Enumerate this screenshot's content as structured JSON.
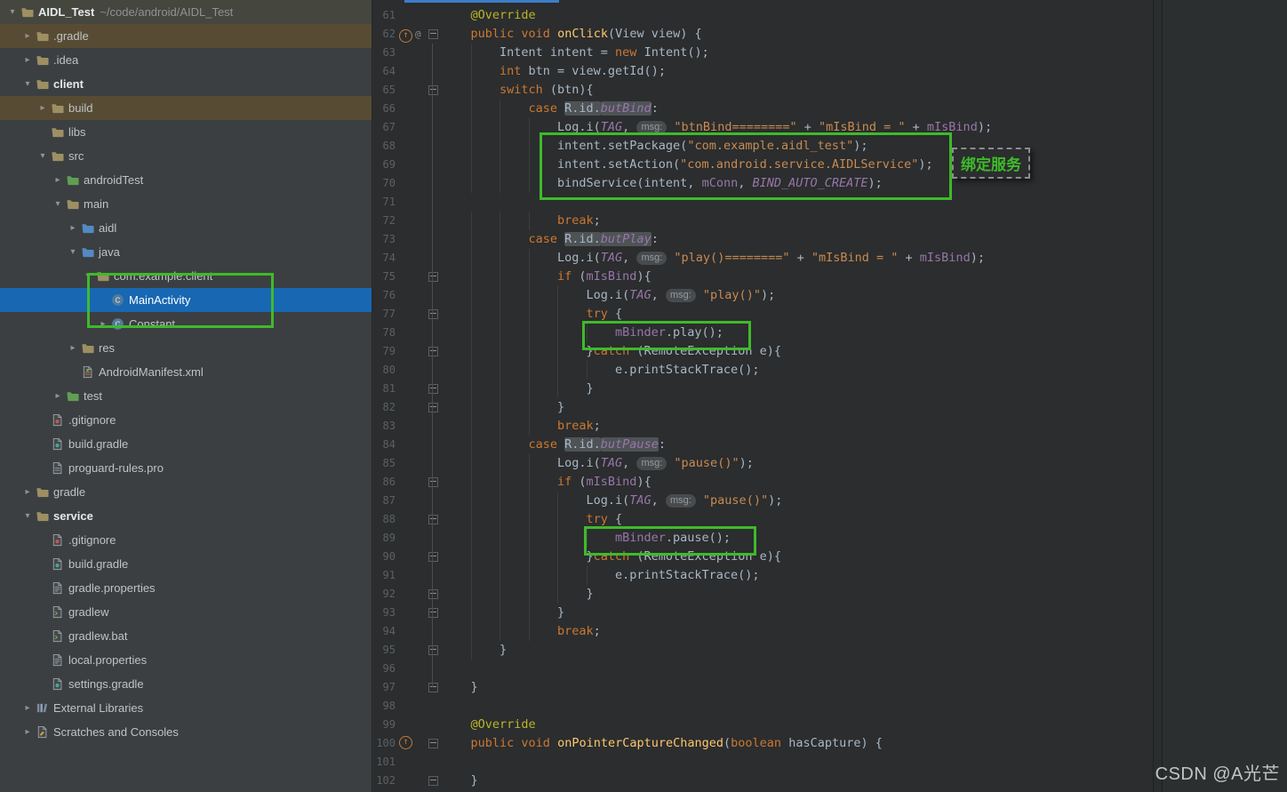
{
  "window": {
    "watermark": "CSDN @A光芒"
  },
  "annotations": {
    "bind_service_label": "绑定服务"
  },
  "sidebar": {
    "items": [
      {
        "label": "AIDL_Test",
        "path": " ~/code/android/AIDL_Test",
        "level": 0,
        "expanded": true,
        "icon": "folder",
        "bold": true,
        "row": "top"
      },
      {
        "label": ".gradle",
        "level": 1,
        "expanded": false,
        "icon": "folder",
        "row": "brown"
      },
      {
        "label": ".idea",
        "level": 1,
        "expanded": false,
        "icon": "folder"
      },
      {
        "label": "client",
        "level": 1,
        "expanded": true,
        "icon": "folder",
        "bold": true
      },
      {
        "label": "build",
        "level": 2,
        "expanded": false,
        "icon": "folder",
        "row": "brown"
      },
      {
        "label": "libs",
        "level": 2,
        "icon": "folder"
      },
      {
        "label": "src",
        "level": 2,
        "expanded": true,
        "icon": "folder"
      },
      {
        "label": "androidTest",
        "level": 3,
        "expanded": false,
        "icon": "folder-green"
      },
      {
        "label": "main",
        "level": 3,
        "expanded": true,
        "icon": "folder"
      },
      {
        "label": "aidl",
        "level": 4,
        "expanded": false,
        "icon": "folder-blue"
      },
      {
        "label": "java",
        "level": 4,
        "expanded": true,
        "icon": "folder-blue"
      },
      {
        "label": "com.example.client",
        "level": 5,
        "expanded": true,
        "icon": "package"
      },
      {
        "label": "MainActivity",
        "level": 6,
        "icon": "class",
        "row": "selected"
      },
      {
        "label": "Constant",
        "level": 6,
        "expanded": false,
        "icon": "class"
      },
      {
        "label": "res",
        "level": 4,
        "expanded": false,
        "icon": "folder"
      },
      {
        "label": "AndroidManifest.xml",
        "level": 4,
        "icon": "manifest"
      },
      {
        "label": "test",
        "level": 3,
        "expanded": false,
        "icon": "folder-green"
      },
      {
        "label": ".gitignore",
        "level": 2,
        "icon": "gitignore"
      },
      {
        "label": "build.gradle",
        "level": 2,
        "icon": "gradle"
      },
      {
        "label": "proguard-rules.pro",
        "level": 2,
        "icon": "file"
      },
      {
        "label": "gradle",
        "level": 1,
        "expanded": false,
        "icon": "folder"
      },
      {
        "label": "service",
        "level": 1,
        "expanded": true,
        "icon": "folder",
        "bold": true
      },
      {
        "label": ".gitignore",
        "level": 2,
        "icon": "gitignore"
      },
      {
        "label": "build.gradle",
        "level": 2,
        "icon": "gradle"
      },
      {
        "label": "gradle.properties",
        "level": 2,
        "icon": "properties"
      },
      {
        "label": "gradlew",
        "level": 2,
        "icon": "gradlew"
      },
      {
        "label": "gradlew.bat",
        "level": 2,
        "icon": "gradlew"
      },
      {
        "label": "local.properties",
        "level": 2,
        "icon": "properties"
      },
      {
        "label": "settings.gradle",
        "level": 2,
        "icon": "gradle"
      },
      {
        "label": "External Libraries",
        "level": 1,
        "expanded": false,
        "icon": "library"
      },
      {
        "label": "Scratches and Consoles",
        "level": 1,
        "expanded": false,
        "icon": "scratch"
      }
    ]
  },
  "editor": {
    "lines": [
      {
        "n": 61,
        "ind": 1,
        "tokens": [
          [
            "ann",
            "@Override"
          ]
        ]
      },
      {
        "n": 62,
        "ind": 1,
        "gutter": [
          "override",
          "at"
        ],
        "fold": true,
        "tokens": [
          [
            "k",
            "public"
          ],
          [
            "p",
            " "
          ],
          [
            "k",
            "void"
          ],
          [
            "p",
            " "
          ],
          [
            "m",
            "onClick"
          ],
          [
            "p",
            "(View view) {"
          ]
        ]
      },
      {
        "n": 63,
        "ind": 2,
        "tokens": [
          [
            "p",
            "Intent intent = "
          ],
          [
            "k",
            "new"
          ],
          [
            "p",
            " Intent();"
          ]
        ]
      },
      {
        "n": 64,
        "ind": 2,
        "tokens": [
          [
            "k",
            "int"
          ],
          [
            "p",
            " btn = view.getId();"
          ]
        ]
      },
      {
        "n": 65,
        "ind": 2,
        "fold": true,
        "tokens": [
          [
            "k",
            "switch"
          ],
          [
            "p",
            " (btn){"
          ]
        ]
      },
      {
        "n": 66,
        "ind": 3,
        "tokens": [
          [
            "k",
            "case"
          ],
          [
            "p",
            " "
          ],
          [
            "p hl",
            "R.id."
          ],
          [
            "sf hl",
            "butBind"
          ],
          [
            "p",
            ":"
          ]
        ]
      },
      {
        "n": 67,
        "ind": 4,
        "tokens": [
          [
            "p",
            "Log.i("
          ],
          [
            "sf",
            "TAG"
          ],
          [
            "p",
            ", "
          ],
          [
            "hint",
            "msg:"
          ],
          [
            "p",
            " "
          ],
          [
            "s",
            "\"btnBind========\""
          ],
          [
            "p",
            " + "
          ],
          [
            "s",
            "\"mIsBind = \""
          ],
          [
            "p",
            " + "
          ],
          [
            "f",
            "mIsBind"
          ],
          [
            "p",
            ");"
          ]
        ]
      },
      {
        "n": 68,
        "ind": 4,
        "tokens": [
          [
            "p",
            "intent.setPackage("
          ],
          [
            "s",
            "\"com.example.aidl_test\""
          ],
          [
            "p",
            ");"
          ]
        ]
      },
      {
        "n": 69,
        "ind": 4,
        "tokens": [
          [
            "p",
            "intent.setAction("
          ],
          [
            "s",
            "\"com.android.service.AIDLService\""
          ],
          [
            "p",
            ");"
          ]
        ]
      },
      {
        "n": 70,
        "ind": 4,
        "tokens": [
          [
            "p",
            "bindService(intent, "
          ],
          [
            "f",
            "mConn"
          ],
          [
            "p",
            ", "
          ],
          [
            "sf",
            "BIND_AUTO_CREATE"
          ],
          [
            "p",
            ");"
          ]
        ]
      },
      {
        "n": 71,
        "ind": 0,
        "tokens": []
      },
      {
        "n": 72,
        "ind": 4,
        "tokens": [
          [
            "k",
            "break"
          ],
          [
            "p",
            ";"
          ]
        ]
      },
      {
        "n": 73,
        "ind": 3,
        "tokens": [
          [
            "k",
            "case"
          ],
          [
            "p",
            " "
          ],
          [
            "p hl",
            "R.id."
          ],
          [
            "sf hl",
            "butPlay"
          ],
          [
            "p",
            ":"
          ]
        ]
      },
      {
        "n": 74,
        "ind": 4,
        "tokens": [
          [
            "p",
            "Log.i("
          ],
          [
            "sf",
            "TAG"
          ],
          [
            "p",
            ", "
          ],
          [
            "hint",
            "msg:"
          ],
          [
            "p",
            " "
          ],
          [
            "s",
            "\"play()========\""
          ],
          [
            "p",
            " + "
          ],
          [
            "s",
            "\"mIsBind = \""
          ],
          [
            "p",
            " + "
          ],
          [
            "f",
            "mIsBind"
          ],
          [
            "p",
            ");"
          ]
        ]
      },
      {
        "n": 75,
        "ind": 4,
        "fold": true,
        "tokens": [
          [
            "k",
            "if"
          ],
          [
            "p",
            " ("
          ],
          [
            "f",
            "mIsBind"
          ],
          [
            "p",
            "){"
          ]
        ]
      },
      {
        "n": 76,
        "ind": 5,
        "tokens": [
          [
            "p",
            "Log.i("
          ],
          [
            "sf",
            "TAG"
          ],
          [
            "p",
            ", "
          ],
          [
            "hint",
            "msg:"
          ],
          [
            "p",
            " "
          ],
          [
            "s",
            "\"play()\""
          ],
          [
            "p",
            ");"
          ]
        ]
      },
      {
        "n": 77,
        "ind": 5,
        "fold": true,
        "tokens": [
          [
            "k",
            "try"
          ],
          [
            "p",
            " {"
          ]
        ]
      },
      {
        "n": 78,
        "ind": 6,
        "tokens": [
          [
            "f",
            "mBinder"
          ],
          [
            "p",
            ".play();"
          ]
        ]
      },
      {
        "n": 79,
        "ind": 5,
        "fold": true,
        "tokens": [
          [
            "p",
            "}"
          ],
          [
            "k",
            "catch"
          ],
          [
            "p",
            " (RemoteException e){"
          ]
        ]
      },
      {
        "n": 80,
        "ind": 6,
        "tokens": [
          [
            "p",
            "e.printStackTrace();"
          ]
        ]
      },
      {
        "n": 81,
        "ind": 5,
        "fold": true,
        "tokens": [
          [
            "p",
            "}"
          ]
        ]
      },
      {
        "n": 82,
        "ind": 4,
        "fold": true,
        "tokens": [
          [
            "p",
            "}"
          ]
        ]
      },
      {
        "n": 83,
        "ind": 4,
        "tokens": [
          [
            "k",
            "break"
          ],
          [
            "p",
            ";"
          ]
        ]
      },
      {
        "n": 84,
        "ind": 3,
        "tokens": [
          [
            "k",
            "case"
          ],
          [
            "p",
            " "
          ],
          [
            "p hl",
            "R.id."
          ],
          [
            "sf hl",
            "butPause"
          ],
          [
            "p",
            ":"
          ]
        ]
      },
      {
        "n": 85,
        "ind": 4,
        "tokens": [
          [
            "p",
            "Log.i("
          ],
          [
            "sf",
            "TAG"
          ],
          [
            "p",
            ", "
          ],
          [
            "hint",
            "msg:"
          ],
          [
            "p",
            " "
          ],
          [
            "s",
            "\"pause()\""
          ],
          [
            "p",
            ");"
          ]
        ]
      },
      {
        "n": 86,
        "ind": 4,
        "fold": true,
        "tokens": [
          [
            "k",
            "if"
          ],
          [
            "p",
            " ("
          ],
          [
            "f",
            "mIsBind"
          ],
          [
            "p",
            "){"
          ]
        ]
      },
      {
        "n": 87,
        "ind": 5,
        "tokens": [
          [
            "p",
            "Log.i("
          ],
          [
            "sf",
            "TAG"
          ],
          [
            "p",
            ", "
          ],
          [
            "hint",
            "msg:"
          ],
          [
            "p",
            " "
          ],
          [
            "s",
            "\"pause()\""
          ],
          [
            "p",
            ");"
          ]
        ]
      },
      {
        "n": 88,
        "ind": 5,
        "fold": true,
        "tokens": [
          [
            "k",
            "try"
          ],
          [
            "p",
            " {"
          ]
        ]
      },
      {
        "n": 89,
        "ind": 6,
        "tokens": [
          [
            "f",
            "mBinder"
          ],
          [
            "p",
            ".pause();"
          ]
        ]
      },
      {
        "n": 90,
        "ind": 5,
        "fold": true,
        "tokens": [
          [
            "p",
            "}"
          ],
          [
            "k",
            "catch"
          ],
          [
            "p",
            " (RemoteException e){"
          ]
        ]
      },
      {
        "n": 91,
        "ind": 6,
        "tokens": [
          [
            "p",
            "e.printStackTrace();"
          ]
        ]
      },
      {
        "n": 92,
        "ind": 5,
        "fold": true,
        "tokens": [
          [
            "p",
            "}"
          ]
        ]
      },
      {
        "n": 93,
        "ind": 4,
        "fold": true,
        "tokens": [
          [
            "p",
            "}"
          ]
        ]
      },
      {
        "n": 94,
        "ind": 4,
        "tokens": [
          [
            "k",
            "break"
          ],
          [
            "p",
            ";"
          ]
        ]
      },
      {
        "n": 95,
        "ind": 2,
        "fold": true,
        "tokens": [
          [
            "p",
            "}"
          ]
        ]
      },
      {
        "n": 96,
        "ind": 0,
        "tokens": []
      },
      {
        "n": 97,
        "ind": 1,
        "fold": true,
        "tokens": [
          [
            "p",
            "}"
          ]
        ]
      },
      {
        "n": 98,
        "ind": 0,
        "tokens": []
      },
      {
        "n": 99,
        "ind": 1,
        "tokens": [
          [
            "ann",
            "@Override"
          ]
        ]
      },
      {
        "n": 100,
        "ind": 1,
        "gutter": [
          "override"
        ],
        "fold": true,
        "tokens": [
          [
            "k",
            "public"
          ],
          [
            "p",
            " "
          ],
          [
            "k",
            "void"
          ],
          [
            "p",
            " "
          ],
          [
            "m",
            "onPointerCaptureChanged"
          ],
          [
            "p",
            "("
          ],
          [
            "k",
            "boolean"
          ],
          [
            "p",
            " hasCapture) {"
          ]
        ]
      },
      {
        "n": 101,
        "ind": 0,
        "tokens": []
      },
      {
        "n": 102,
        "ind": 1,
        "fold": true,
        "tokens": [
          [
            "p",
            "}"
          ]
        ]
      }
    ]
  },
  "colors": {
    "annotation_green": "#3FBA2A",
    "selection_blue": "#1767B3",
    "modified_row_brown": "#574C33",
    "editor_bg": "#2B2D2E",
    "sidebar_bg": "#3B3F42"
  }
}
